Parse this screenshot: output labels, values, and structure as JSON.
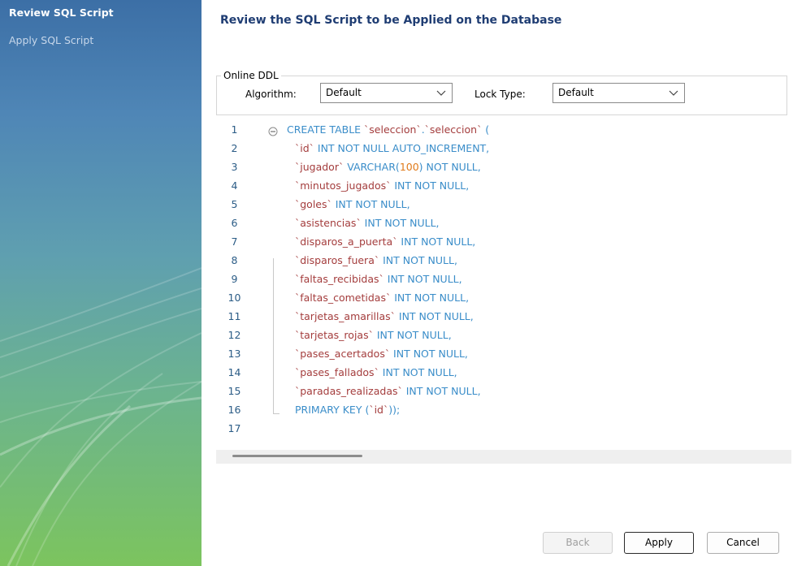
{
  "sidebar": {
    "steps": [
      {
        "label": "Review SQL Script",
        "active": true
      },
      {
        "label": "Apply SQL Script",
        "active": false
      }
    ]
  },
  "main": {
    "title": "Review the SQL Script to be Applied on the Database",
    "online_ddl": {
      "legend": "Online DDL",
      "algorithm_label": "Algorithm:",
      "algorithm_value": "Default",
      "lock_type_label": "Lock Type:",
      "lock_type_value": "Default"
    },
    "script_lines": [
      {
        "n": "1",
        "segments": [
          [
            "kw",
            "CREATE TABLE "
          ],
          [
            "str",
            "`seleccion`"
          ],
          [
            "kw",
            "."
          ],
          [
            "str",
            "`seleccion`"
          ],
          [
            "kw",
            " ("
          ]
        ]
      },
      {
        "n": "2",
        "segments": [
          [
            "str",
            "`id`"
          ],
          [
            "kw",
            " INT NOT NULL AUTO_INCREMENT,"
          ]
        ]
      },
      {
        "n": "3",
        "segments": [
          [
            "str",
            "`jugador`"
          ],
          [
            "kw",
            " VARCHAR("
          ],
          [
            "num",
            "100"
          ],
          [
            "kw",
            ") NOT NULL,"
          ]
        ]
      },
      {
        "n": "4",
        "segments": [
          [
            "str",
            "`minutos_jugados`"
          ],
          [
            "kw",
            " INT NOT NULL,"
          ]
        ]
      },
      {
        "n": "5",
        "segments": [
          [
            "str",
            "`goles`"
          ],
          [
            "kw",
            " INT NOT NULL,"
          ]
        ]
      },
      {
        "n": "6",
        "segments": [
          [
            "str",
            "`asistencias`"
          ],
          [
            "kw",
            " INT NOT NULL,"
          ]
        ]
      },
      {
        "n": "7",
        "segments": [
          [
            "str",
            "`disparos_a_puerta`"
          ],
          [
            "kw",
            " INT NOT NULL,"
          ]
        ]
      },
      {
        "n": "8",
        "segments": [
          [
            "str",
            "`disparos_fuera`"
          ],
          [
            "kw",
            " INT NOT NULL,"
          ]
        ]
      },
      {
        "n": "9",
        "segments": [
          [
            "str",
            "`faltas_recibidas`"
          ],
          [
            "kw",
            " INT NOT NULL,"
          ]
        ]
      },
      {
        "n": "10",
        "segments": [
          [
            "str",
            "`faltas_cometidas`"
          ],
          [
            "kw",
            " INT NOT NULL,"
          ]
        ]
      },
      {
        "n": "11",
        "segments": [
          [
            "str",
            "`tarjetas_amarillas`"
          ],
          [
            "kw",
            " INT NOT NULL,"
          ]
        ]
      },
      {
        "n": "12",
        "segments": [
          [
            "str",
            "`tarjetas_rojas`"
          ],
          [
            "kw",
            " INT NOT NULL,"
          ]
        ]
      },
      {
        "n": "13",
        "segments": [
          [
            "str",
            "`pases_acertados`"
          ],
          [
            "kw",
            " INT NOT NULL,"
          ]
        ]
      },
      {
        "n": "14",
        "segments": [
          [
            "str",
            "`pases_fallados`"
          ],
          [
            "kw",
            " INT NOT NULL,"
          ]
        ]
      },
      {
        "n": "15",
        "segments": [
          [
            "str",
            "`paradas_realizadas`"
          ],
          [
            "kw",
            " INT NOT NULL,"
          ]
        ]
      },
      {
        "n": "16",
        "segments": [
          [
            "kw",
            "PRIMARY KEY ("
          ],
          [
            "str",
            "`id`"
          ],
          [
            "kw",
            "));"
          ]
        ]
      },
      {
        "n": "17",
        "segments": []
      }
    ]
  },
  "buttons": {
    "back": "Back",
    "apply": "Apply",
    "cancel": "Cancel"
  },
  "colors": {
    "keyword": "#3a8dc9",
    "identifier": "#a43d3d",
    "number": "#e07a1a",
    "title": "#1f3d73"
  }
}
